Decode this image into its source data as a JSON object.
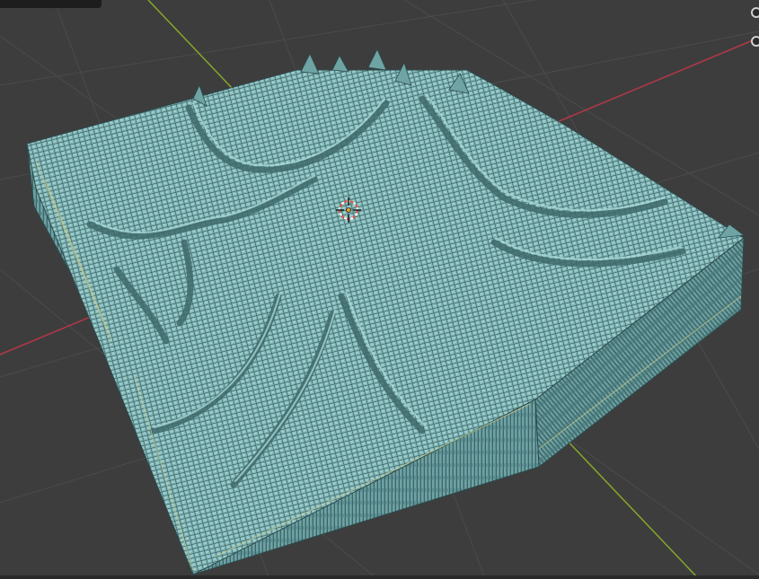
{
  "app": {
    "title": ""
  },
  "viewport": {
    "background": "#3d3d3d",
    "grid_color": "#4a4a4a",
    "x_axis_color": "#b43848",
    "y_axis_color": "#86a82b",
    "mesh_top_color": "#7fb5b6",
    "mesh_side_color": "#5b8e90",
    "mesh_edge_color": "#2d4a4c",
    "wire_highlight_color": "#c7c98a",
    "cursor_color": "#e05038",
    "origin_color": "#e8a020",
    "icons": [
      "3d-cursor-icon",
      "origin-point-icon",
      "navigation-gizmo-icon"
    ]
  }
}
